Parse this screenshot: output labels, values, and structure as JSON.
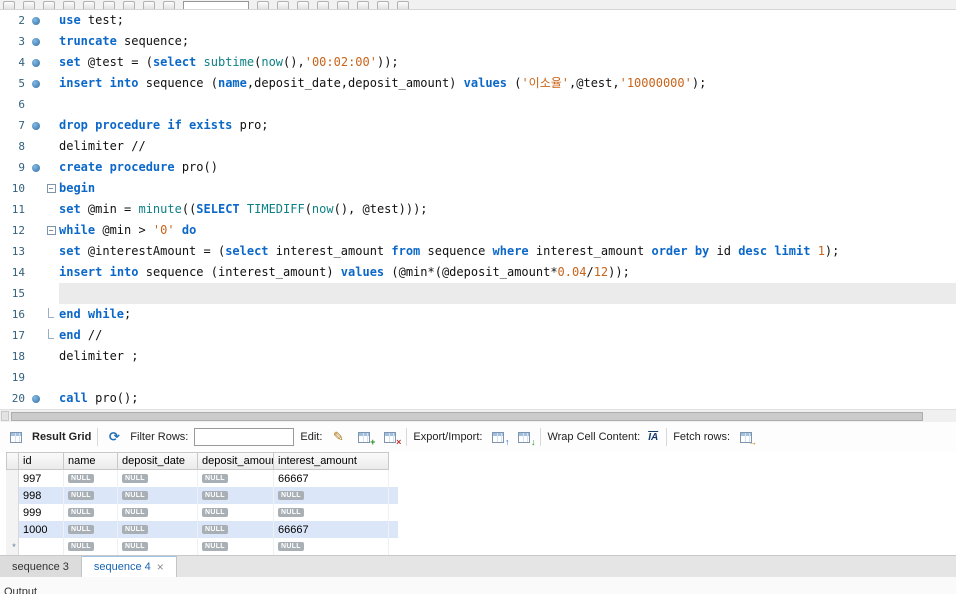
{
  "top_toolbar": {
    "icons": [
      "menu",
      "new-query-tab",
      "open-script",
      "save-script",
      "execute-script",
      "execute-current",
      "explain",
      "stop",
      "toggle-stop-on-error",
      "limit-rows",
      "commit",
      "rollback",
      "autocommit",
      "beautify",
      "find",
      "invisible-chars",
      "wrap-text",
      "options"
    ]
  },
  "editor": {
    "lines": [
      {
        "num": "2",
        "dot": true,
        "tokens": [
          [
            "kw",
            "use"
          ],
          [
            "pl",
            " test;"
          ]
        ]
      },
      {
        "num": "3",
        "dot": true,
        "tokens": [
          [
            "kw",
            "truncate"
          ],
          [
            "pl",
            " sequence;"
          ]
        ]
      },
      {
        "num": "4",
        "dot": true,
        "tokens": [
          [
            "kw",
            "set"
          ],
          [
            "pl",
            " @test = ("
          ],
          [
            "kw",
            "select"
          ],
          [
            "pl",
            " "
          ],
          [
            "fn",
            "subtime"
          ],
          [
            "pl",
            "("
          ],
          [
            "fn",
            "now"
          ],
          [
            "pl",
            "(),"
          ],
          [
            "str",
            "'00:02:00'"
          ],
          [
            "pl",
            "));"
          ]
        ]
      },
      {
        "num": "5",
        "dot": true,
        "tokens": [
          [
            "kw",
            "insert"
          ],
          [
            "pl",
            " "
          ],
          [
            "kw",
            "into"
          ],
          [
            "pl",
            " sequence ("
          ],
          [
            "kw",
            "name"
          ],
          [
            "pl",
            ",deposit_date,deposit_amount) "
          ],
          [
            "kw",
            "values"
          ],
          [
            "pl",
            " ("
          ],
          [
            "str",
            "'이소율'"
          ],
          [
            "pl",
            ",@test,"
          ],
          [
            "str",
            "'10000000'"
          ],
          [
            "pl",
            ");"
          ]
        ]
      },
      {
        "num": "6",
        "tokens": []
      },
      {
        "num": "7",
        "dot": true,
        "tokens": [
          [
            "kw",
            "drop procedure if exists"
          ],
          [
            "pl",
            " pro;"
          ]
        ]
      },
      {
        "num": "8",
        "tokens": [
          [
            "pl",
            "delimiter //"
          ]
        ]
      },
      {
        "num": "9",
        "dot": true,
        "tokens": [
          [
            "kw",
            "create procedure"
          ],
          [
            "pl",
            " pro()"
          ]
        ]
      },
      {
        "num": "10",
        "fold": "open",
        "tokens": [
          [
            "kw",
            "begin"
          ]
        ]
      },
      {
        "num": "11",
        "tokens": [
          [
            "kw",
            "set"
          ],
          [
            "pl",
            " @min = "
          ],
          [
            "fn",
            "minute"
          ],
          [
            "pl",
            "(("
          ],
          [
            "kw",
            "SELECT"
          ],
          [
            "pl",
            " "
          ],
          [
            "fn",
            "TIMEDIFF"
          ],
          [
            "pl",
            "("
          ],
          [
            "fn",
            "now"
          ],
          [
            "pl",
            "(), @test)));"
          ]
        ]
      },
      {
        "num": "12",
        "fold": "open",
        "tokens": [
          [
            "kw",
            "while"
          ],
          [
            "pl",
            " @min > "
          ],
          [
            "str",
            "'0'"
          ],
          [
            "pl",
            " "
          ],
          [
            "kw",
            "do"
          ]
        ]
      },
      {
        "num": "13",
        "tokens": [
          [
            "kw",
            "set"
          ],
          [
            "pl",
            " @interestAmount = ("
          ],
          [
            "kw",
            "select"
          ],
          [
            "pl",
            " interest_amount "
          ],
          [
            "kw",
            "from"
          ],
          [
            "pl",
            " sequence "
          ],
          [
            "kw",
            "where"
          ],
          [
            "pl",
            " interest_amount "
          ],
          [
            "kw",
            "order by"
          ],
          [
            "pl",
            " id "
          ],
          [
            "kw",
            "desc"
          ],
          [
            "pl",
            " "
          ],
          [
            "kw",
            "limit"
          ],
          [
            "pl",
            " "
          ],
          [
            "num",
            "1"
          ],
          [
            "pl",
            ");"
          ]
        ]
      },
      {
        "num": "14",
        "tokens": [
          [
            "kw",
            "insert"
          ],
          [
            "pl",
            " "
          ],
          [
            "kw",
            "into"
          ],
          [
            "pl",
            " sequence (interest_amount) "
          ],
          [
            "kw",
            "values"
          ],
          [
            "pl",
            " (@min*(@deposit_amount*"
          ],
          [
            "num",
            "0.04"
          ],
          [
            "pl",
            "/"
          ],
          [
            "num",
            "12"
          ],
          [
            "pl",
            "));"
          ]
        ]
      },
      {
        "num": "15",
        "hl": true,
        "tokens": []
      },
      {
        "num": "16",
        "fold": "end",
        "tokens": [
          [
            "kw",
            "end while"
          ],
          [
            "pl",
            ";"
          ]
        ]
      },
      {
        "num": "17",
        "fold": "end",
        "tokens": [
          [
            "kw",
            "end"
          ],
          [
            "pl",
            " //"
          ]
        ]
      },
      {
        "num": "18",
        "tokens": [
          [
            "pl",
            "delimiter ;"
          ]
        ]
      },
      {
        "num": "19",
        "tokens": []
      },
      {
        "num": "20",
        "dot": true,
        "tokens": [
          [
            "kw",
            "call"
          ],
          [
            "pl",
            " pro();"
          ]
        ]
      }
    ]
  },
  "result_toolbar": {
    "title": "Result Grid",
    "filter_label": "Filter Rows:",
    "filter_value": "",
    "edit_label": "Edit:",
    "export_label": "Export/Import:",
    "wrap_label": "Wrap Cell Content:",
    "fetch_label": "Fetch rows:",
    "icons": [
      "result-grid-icon",
      "refresh-icon",
      "edit-cell-icon",
      "insert-row-icon",
      "delete-row-icon",
      "export-icon",
      "import-icon",
      "wrap-cell-content-icon",
      "fetch-rows-icon"
    ]
  },
  "grid": {
    "columns": [
      "id",
      "name",
      "deposit_date",
      "deposit_amount",
      "interest_amount"
    ],
    "rows": [
      {
        "id": "997",
        "cells": [
          "NULL",
          "NULL",
          "NULL",
          "66667"
        ],
        "selected": false
      },
      {
        "id": "998",
        "cells": [
          "NULL",
          "NULL",
          "NULL",
          "NULL"
        ],
        "selected": true
      },
      {
        "id": "999",
        "cells": [
          "NULL",
          "NULL",
          "NULL",
          "NULL"
        ],
        "selected": false
      },
      {
        "id": "1000",
        "cells": [
          "NULL",
          "NULL",
          "NULL",
          "66667"
        ],
        "selected": true
      },
      {
        "id": "",
        "cells": [
          "NULL",
          "NULL",
          "NULL",
          "NULL"
        ],
        "selected": false,
        "new_row": true
      }
    ]
  },
  "tabs": [
    {
      "label": "sequence 3",
      "active": false,
      "closable": false
    },
    {
      "label": "sequence 4",
      "active": true,
      "closable": true
    }
  ],
  "bottom_panel": {
    "label": "Output"
  },
  "colors": {
    "keyword": "#0c68c8",
    "function": "#0e8186",
    "string": "#c8641a",
    "number": "#c8641a",
    "line_number": "#33607c",
    "selected_row": "#dbe7f8",
    "active_tab_text": "#1863b0",
    "null_badge": "#a8b0b6"
  }
}
